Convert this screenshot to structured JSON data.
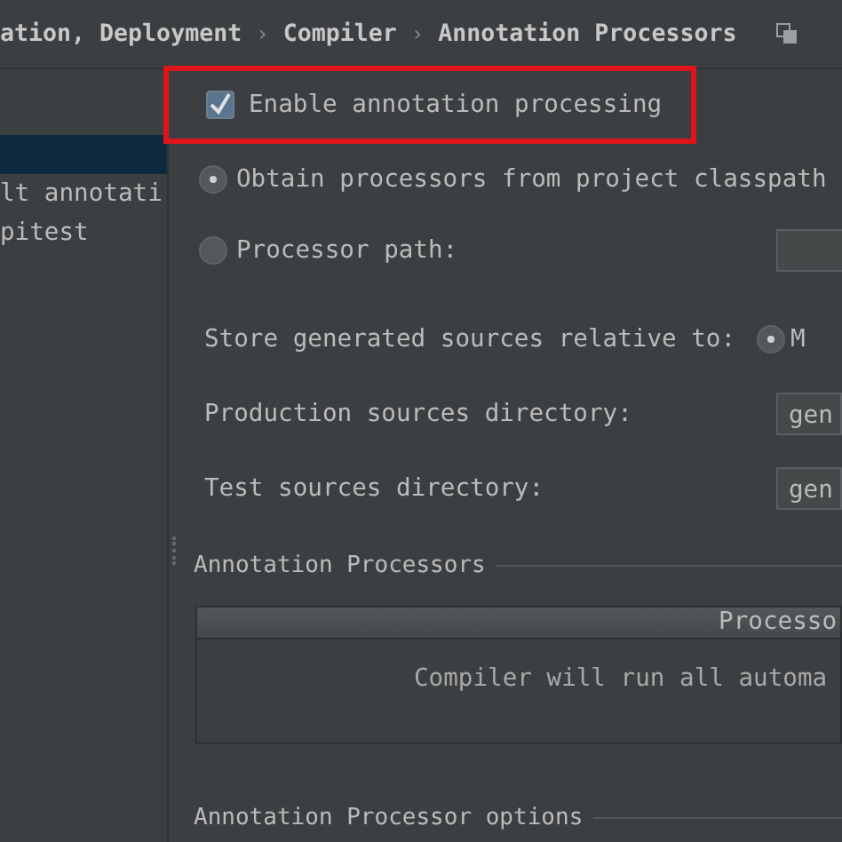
{
  "breadcrumb": [
    {
      "kind": "crumb",
      "text": "ation, Deployment"
    },
    {
      "kind": "separator",
      "text": "›"
    },
    {
      "kind": "crumb",
      "text": "Compiler"
    },
    {
      "kind": "separator",
      "text": "›"
    },
    {
      "kind": "crumb",
      "text": "Annotation Processors"
    }
  ],
  "sidebar": {
    "items": [
      {
        "selected": true
      },
      {
        "label": "lt annotati",
        "selected": false
      },
      {
        "label": "pitest",
        "selected": false
      }
    ]
  },
  "enable": {
    "label": "Enable annotation processing",
    "checked": true,
    "highlighted": true
  },
  "processor_source": [
    {
      "label": "Obtain processors from project classpath",
      "selected": true
    },
    {
      "label": "Processor path:",
      "selected": false
    }
  ],
  "store": {
    "label": "Store generated sources relative to:",
    "options": [
      {
        "label": "M",
        "selected": true
      }
    ]
  },
  "directories": [
    {
      "label": "Production sources directory:",
      "value": "gen"
    },
    {
      "label": "Test sources directory:",
      "value": "gen"
    }
  ],
  "processors_table": {
    "title": "Annotation Processors",
    "columns": [
      "Processo"
    ],
    "empty_text": "Compiler will run all automa"
  },
  "options_title": "Annotation Processor options"
}
